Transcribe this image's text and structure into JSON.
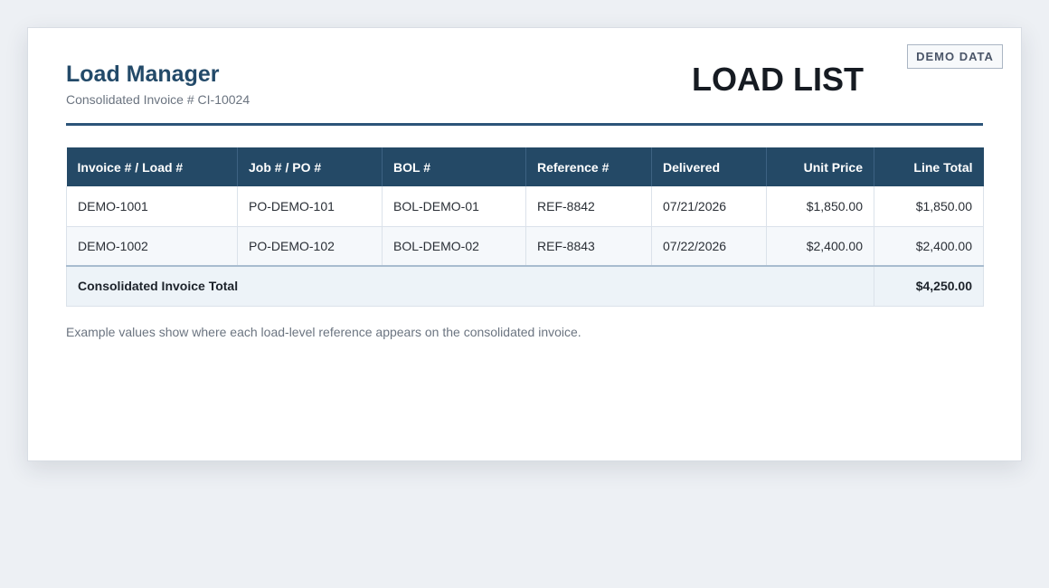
{
  "badge": "DEMO DATA",
  "brand": "Load Manager",
  "subtitle": "Consolidated Invoice # CI-10024",
  "doc_title": "LOAD LIST",
  "table": {
    "headers": [
      "Invoice # / Load #",
      "Job # / PO #",
      "BOL #",
      "Reference #",
      "Delivered",
      "Unit Price",
      "Line Total"
    ],
    "rows": [
      [
        "DEMO-1001",
        "PO-DEMO-101",
        "BOL-DEMO-01",
        "REF-8842",
        "07/21/2026",
        "$1,850.00",
        "$1,850.00"
      ],
      [
        "DEMO-1002",
        "PO-DEMO-102",
        "BOL-DEMO-02",
        "REF-8843",
        "07/22/2026",
        "$2,400.00",
        "$2,400.00"
      ]
    ],
    "total_label": "Consolidated Invoice Total",
    "total_value": "$4,250.00"
  },
  "note": "Example values show where each load-level reference appears on the consolidated invoice.",
  "colors": {
    "accent": "#244966",
    "background": "#edf0f4"
  }
}
